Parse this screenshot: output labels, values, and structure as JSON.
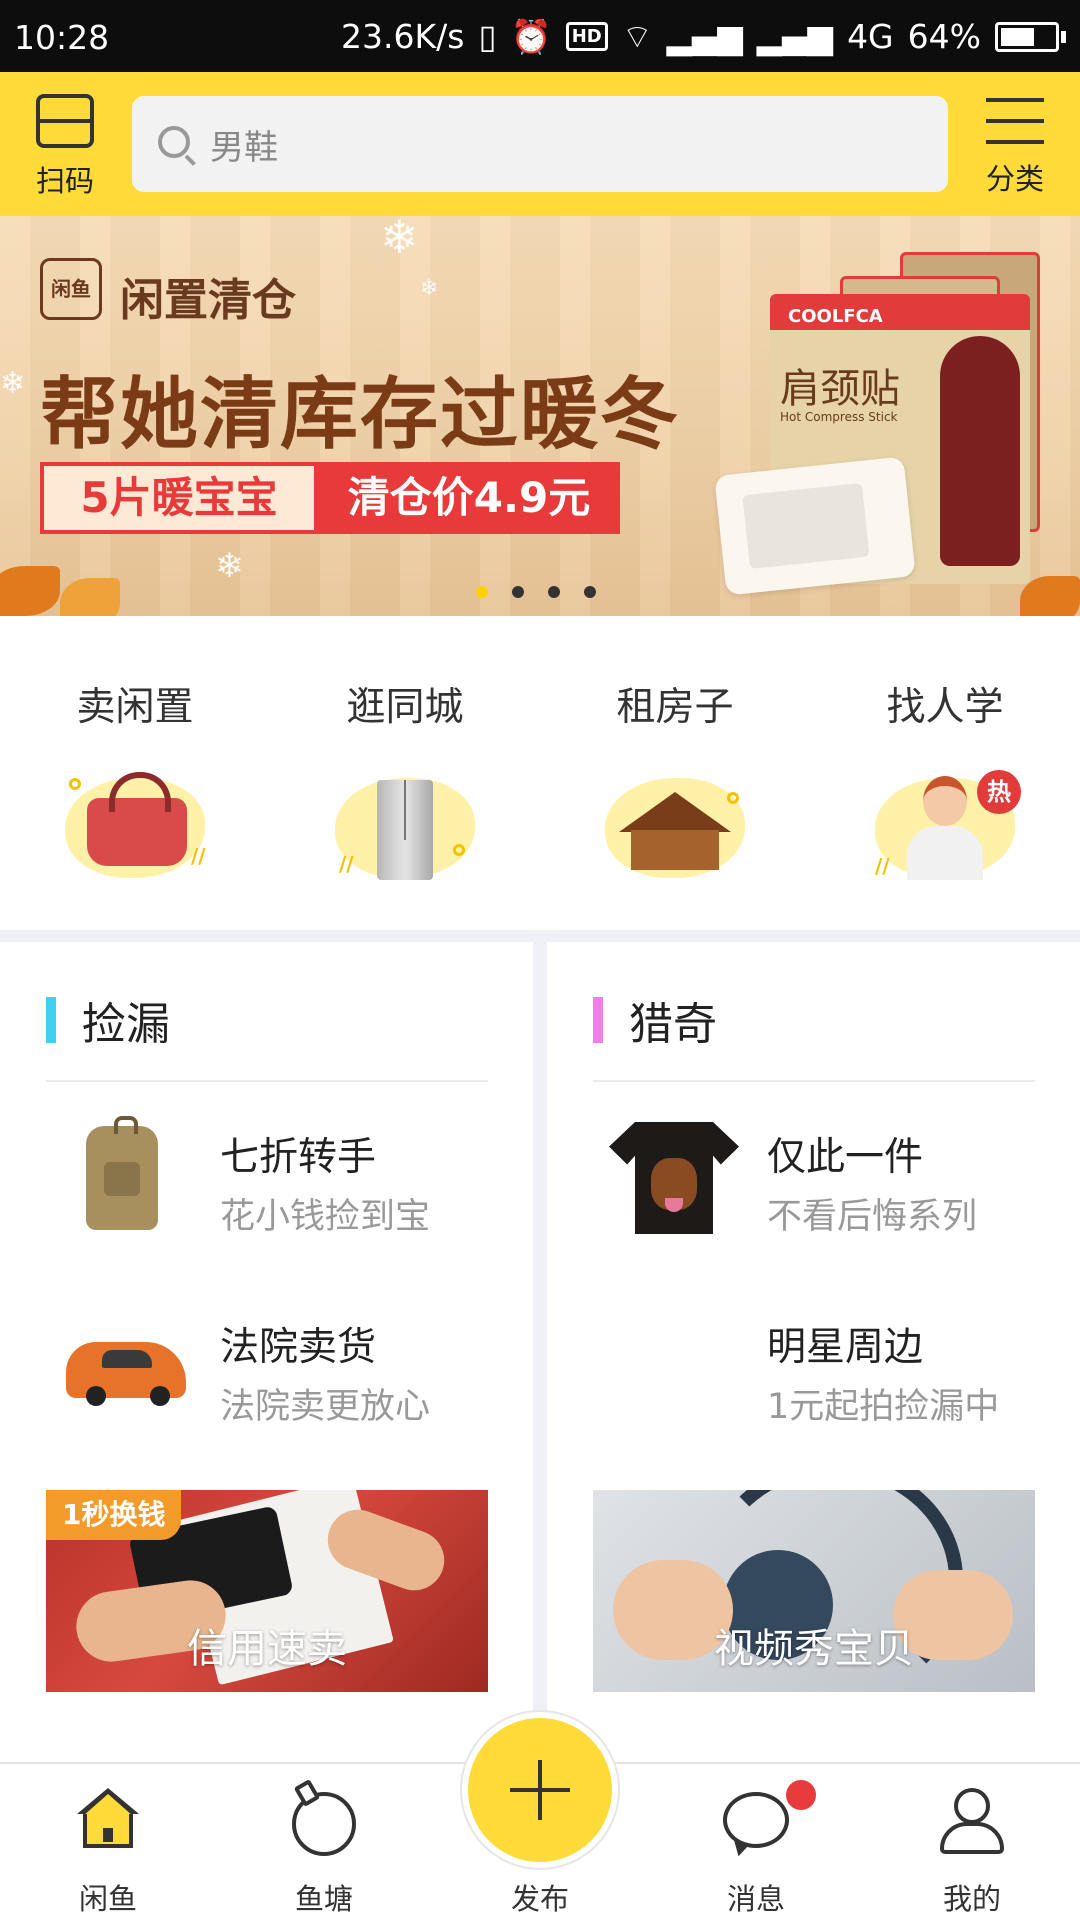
{
  "status_bar": {
    "time": "10:28",
    "speed": "23.6K/s",
    "network": "4G",
    "battery": "64%",
    "battery_level": 0.64,
    "hd": "HD"
  },
  "header": {
    "scan_label": "扫码",
    "search_placeholder": "男鞋",
    "category_label": "分类"
  },
  "banner": {
    "brand_logo_text": "闲鱼",
    "brand": "闲置清仓",
    "headline": "帮她清库存过暖冬",
    "tag_left": "5片暖宝宝",
    "tag_right": "清仓价4.9元",
    "product_brand": "COOLFCA",
    "product_name": "肩颈贴",
    "product_sub": "Hot Compress Stick",
    "slides": 4,
    "active_slide": 1
  },
  "categories": [
    {
      "label": "卖闲置",
      "icon": "handbag-icon"
    },
    {
      "label": "逛同城",
      "icon": "fridge-icon"
    },
    {
      "label": "租房子",
      "icon": "house-icon"
    },
    {
      "label": "找人学",
      "icon": "person-icon",
      "badge": "热"
    }
  ],
  "sections": {
    "left": {
      "title": "捡漏",
      "accent": "#3fd0f0",
      "items": [
        {
          "name": "七折转手",
          "desc": "花小钱捡到宝",
          "icon": "backpack-icon"
        },
        {
          "name": "法院卖货",
          "desc": "法院卖更放心",
          "icon": "car-icon"
        }
      ],
      "promo": {
        "badge": "1秒换钱",
        "caption": "信用速卖"
      }
    },
    "right": {
      "title": "猎奇",
      "accent": "#f07fe8",
      "items": [
        {
          "name": "仅此一件",
          "desc": "不看后悔系列",
          "icon": "tshirt-icon"
        },
        {
          "name": "明星周边",
          "desc": "1元起拍捡漏中",
          "icon": ""
        }
      ],
      "promo": {
        "caption": "视频秀宝贝"
      }
    }
  },
  "tabbar": {
    "tabs": [
      {
        "label": "闲鱼",
        "icon": "home-icon",
        "active": true
      },
      {
        "label": "鱼塘",
        "icon": "pond-icon"
      },
      {
        "label": "发布",
        "icon": "plus-icon"
      },
      {
        "label": "消息",
        "icon": "message-icon",
        "unread_dot": true
      },
      {
        "label": "我的",
        "icon": "profile-icon"
      }
    ]
  },
  "colors": {
    "brand_yellow": "#ffdb3a",
    "badge_red": "#e83b3b"
  }
}
